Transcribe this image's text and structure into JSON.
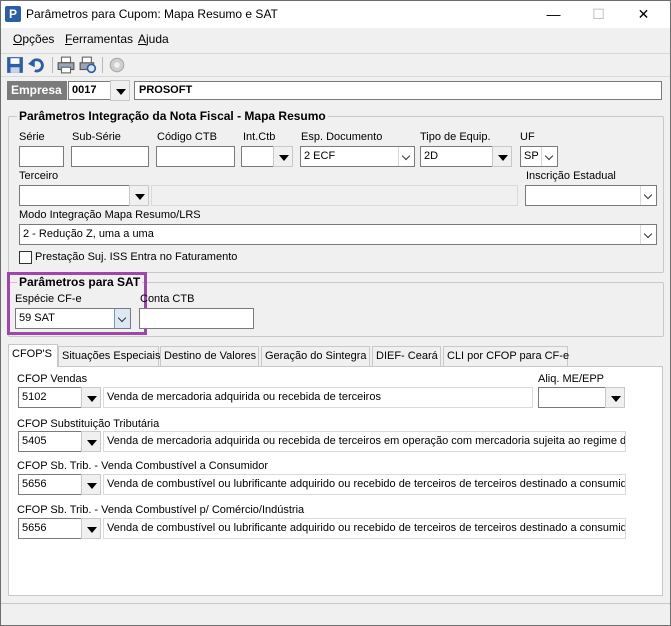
{
  "window": {
    "title": "Parâmetros para Cupom: Mapa Resumo e SAT",
    "app_icon": "P",
    "minimize": "—",
    "maximize": "☐",
    "close": "✕"
  },
  "menu": {
    "items": [
      {
        "label": "Opções",
        "accel": "O",
        "rest": "pções"
      },
      {
        "label": "Ferramentas",
        "accel": "F",
        "rest": "erramentas"
      },
      {
        "label": "Ajuda",
        "accel": "A",
        "rest": "juda"
      }
    ]
  },
  "toolbar": {
    "icons": [
      "save-icon",
      "undo-icon",
      "print-icon",
      "print-preview-icon",
      "settings-icon"
    ]
  },
  "empresa": {
    "label": "Empresa",
    "code": "0017",
    "name": "PROSOFT"
  },
  "integracao": {
    "title": "Parâmetros Integração da Nota Fiscal - Mapa Resumo",
    "serie_label": "Série",
    "serie_value": "",
    "subserie_label": "Sub-Série",
    "subserie_value": "",
    "codigo_ctb_label": "Código CTB",
    "codigo_ctb_value": "",
    "intctb_label": "Int.Ctb",
    "intctb_value": "",
    "esp_doc_label": "Esp. Documento",
    "esp_doc_value": "2 ECF",
    "tipo_equip_label": "Tipo de Equip.",
    "tipo_equip_value": "2D",
    "uf_label": "UF",
    "uf_value": "SP",
    "terceiro_label": "Terceiro",
    "terceiro_value": "",
    "terceiro_desc": "",
    "inscricao_label": "Inscrição Estadual",
    "inscricao_value": "",
    "modo_label": "Modo Integração Mapa Resumo/LRS",
    "modo_value": "2 - Redução Z, uma a uma",
    "prestacao_label": "Prestação Suj. ISS Entra no Faturamento"
  },
  "sat": {
    "title": "Parâmetros para SAT",
    "especie_label": "Espécie CF-e",
    "especie_value": "59 SAT",
    "conta_label": "Conta CTB",
    "conta_value": ""
  },
  "tabs": [
    {
      "label": "CFOP'S",
      "active": true
    },
    {
      "label": "Situações Especiais",
      "active": false
    },
    {
      "label": "Destino de Valores",
      "active": false
    },
    {
      "label": "Geração do Sintegra",
      "active": false
    },
    {
      "label": "DIEF- Ceará",
      "active": false
    },
    {
      "label": "CLI por CFOP para CF-e",
      "active": false
    }
  ],
  "cfops": {
    "vendas_label": "CFOP Vendas",
    "vendas_code": "5102",
    "vendas_desc": "Venda de mercadoria adquirida ou recebida de terceiros",
    "aliq_label": "Aliq. ME/EPP",
    "aliq_value": "",
    "subst_label": "CFOP Substituição Tributária",
    "subst_code": "5405",
    "subst_desc": "Venda de mercadoria adquirida ou recebida de terceiros em operação com mercadoria sujeita ao regime de s",
    "comb_cons_label": "CFOP Sb. Trib. - Venda Combustível a Consumidor",
    "comb_cons_code": "5656",
    "comb_cons_desc": "Venda de combustível ou lubrificante adquirido ou recebido de terceiros de terceiros destinado a consumidor",
    "comb_ind_label": "CFOP Sb. Trib. - Venda Combustível p/ Comércio/Indústria",
    "comb_ind_code": "5656",
    "comb_ind_desc": "Venda de combustível ou lubrificante adquirido ou recebido de terceiros de terceiros destinado a consumidor"
  }
}
